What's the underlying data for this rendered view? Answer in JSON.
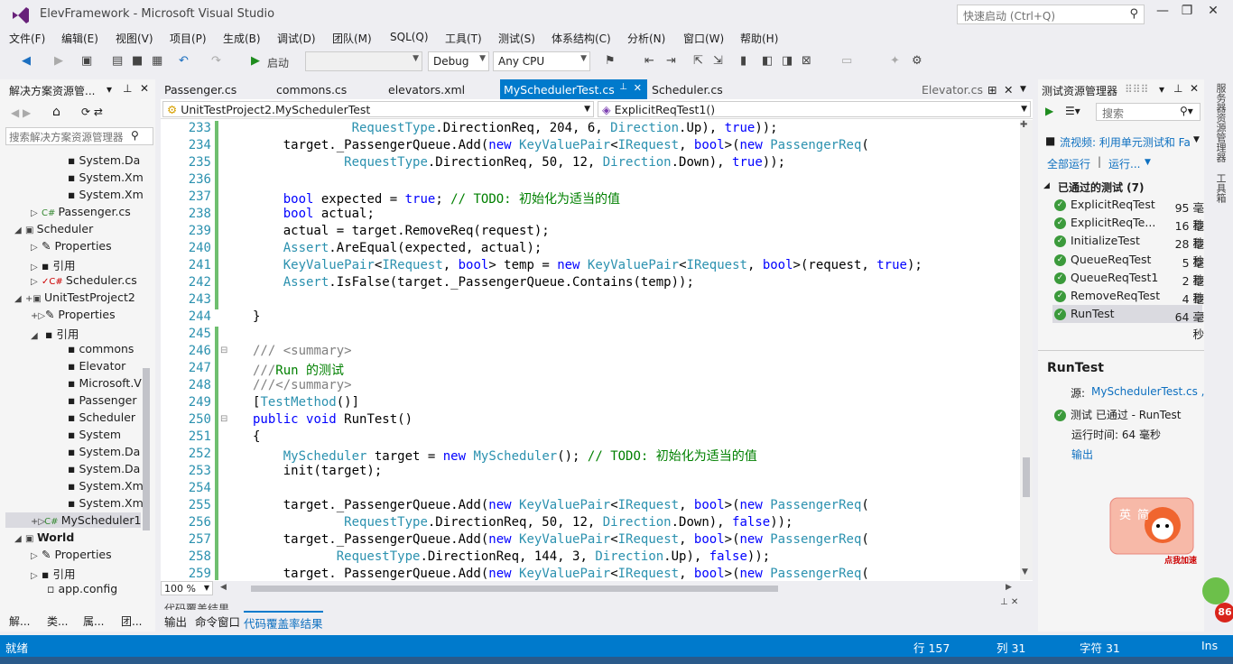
{
  "window": {
    "title": "ElevFramework - Microsoft Visual Studio",
    "quick_launch": "快速启动 (Ctrl+Q)"
  },
  "menu": [
    "文件(F)",
    "编辑(E)",
    "视图(V)",
    "项目(P)",
    "生成(B)",
    "调试(D)",
    "团队(M)",
    "SQL(Q)",
    "工具(T)",
    "测试(S)",
    "体系结构(C)",
    "分析(N)",
    "窗口(W)",
    "帮助(H)"
  ],
  "toolbar": {
    "start_label": "启动",
    "config": "Debug",
    "platform": "Any CPU"
  },
  "solution_explorer": {
    "title": "解决方案资源管...",
    "search_placeholder": "搜索解决方案资源管理器",
    "items": [
      "System.Da",
      "System.Xm",
      "System.Xm",
      "Passenger.cs",
      "Scheduler",
      "Properties",
      "引用",
      "Scheduler.cs",
      "UnitTestProject2",
      "Properties",
      "引用",
      "commons",
      "Elevator",
      "Microsoft.V",
      "Passenger",
      "Scheduler",
      "System",
      "System.Da",
      "System.Da",
      "System.Xm",
      "System.Xm",
      "MyScheduler1",
      "World",
      "Properties",
      "引用",
      "app.config"
    ],
    "bottom_tabs": [
      "解...",
      "类...",
      "属...",
      "团..."
    ]
  },
  "editor": {
    "tabs": [
      "Passenger.cs",
      "commons.cs",
      "elevators.xml",
      "MySchedulerTest.cs",
      "Scheduler.cs",
      "Elevator.cs"
    ],
    "nav_left": "UnitTestProject2.MySchedulerTest",
    "nav_right": "ExplicitReqTest1()",
    "zoom": "100 %",
    "line_numbers": [
      "233",
      "234",
      "235",
      "236",
      "237",
      "238",
      "239",
      "240",
      "241",
      "242",
      "243",
      "244",
      "245",
      "246",
      "247",
      "248",
      "249",
      "250",
      "251",
      "252",
      "253",
      "254",
      "255",
      "256",
      "257",
      "258",
      "259"
    ]
  },
  "bottom_panel": {
    "tabs": [
      "输出",
      "命令窗口",
      "代码覆盖率结果"
    ],
    "peek": "代码覆盖结果"
  },
  "test_explorer": {
    "title": "测试资源管理器",
    "search_placeholder": "搜索",
    "banner": "流视频: 利用单元测试和 Fa",
    "run_all": "全部运行",
    "run": "运行...",
    "group": "已通过的测试 (7)",
    "tests": [
      {
        "name": "ExplicitReqTest",
        "time": "95 毫秒"
      },
      {
        "name": "ExplicitReqTe...",
        "time": "16 毫秒"
      },
      {
        "name": "InitializeTest",
        "time": "28 毫秒"
      },
      {
        "name": "QueueReqTest",
        "time": "5 毫秒"
      },
      {
        "name": "QueueReqTest1",
        "time": "2 毫秒"
      },
      {
        "name": "RemoveReqTest",
        "time": "4 毫秒"
      },
      {
        "name": "RunTest",
        "time": "64 毫秒"
      }
    ],
    "detail": {
      "name": "RunTest",
      "source_label": "源:",
      "source": "MySchedulerTest.cs ,",
      "status": "测试 已通过 - RunTest",
      "runtime": "运行时间: 64 毫秒",
      "output": "输出"
    }
  },
  "side_strip": [
    "服务器资源管理器",
    "工具箱"
  ],
  "status_bar": {
    "ready": "就绪",
    "line": "行 157",
    "col": "列 31",
    "char": "字符 31",
    "mode": "Ins"
  },
  "mascot": {
    "text1": "英",
    "text2": "简",
    "tag": "点我加速",
    "badge": "86"
  },
  "colors": {
    "accent": "#007acc",
    "pass": "#3b9a3b",
    "keyword": "#0000ff",
    "type": "#2b91af",
    "comment": "#008000"
  }
}
